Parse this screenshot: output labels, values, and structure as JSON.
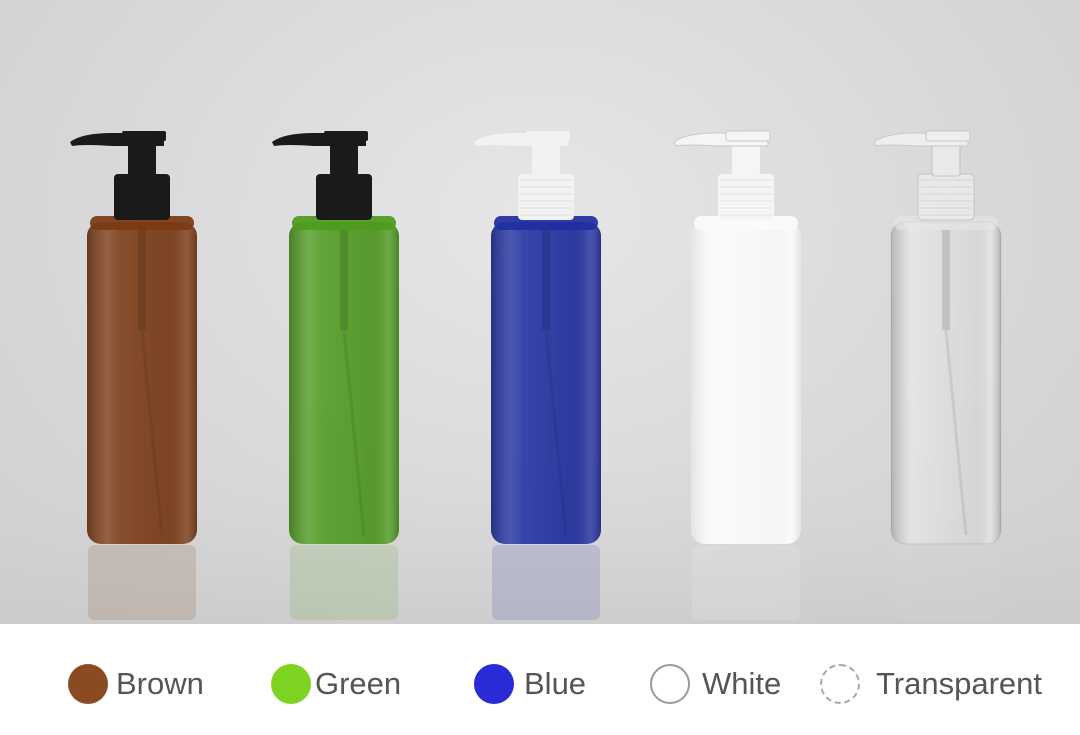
{
  "swatches": [
    {
      "id": "brown",
      "label": "Brown",
      "color": "#8a4a22",
      "border": "none"
    },
    {
      "id": "green",
      "label": "Green",
      "color": "#7ed321",
      "border": "none"
    },
    {
      "id": "blue",
      "label": "Blue",
      "color": "#2a2ad6",
      "border": "none"
    },
    {
      "id": "white",
      "label": "White",
      "color": "#ffffff",
      "border": "solid"
    },
    {
      "id": "transparent",
      "label": "Transparent",
      "color": "#ffffff",
      "border": "dashed"
    }
  ],
  "bottles": [
    {
      "id": "brown",
      "body_color": "#7a3a14",
      "pump_color": "#1a1a1a"
    },
    {
      "id": "green",
      "body_color": "#4e9a1e",
      "pump_color": "#1a1a1a"
    },
    {
      "id": "blue",
      "body_color": "#1f2ea0",
      "pump_color": "#f2f2f2"
    },
    {
      "id": "white",
      "body_color": "#fafafa",
      "pump_color": "#f5f5f5"
    },
    {
      "id": "transparent",
      "body_color": "#e8e8e8",
      "pump_color": "#eeeeee"
    }
  ]
}
